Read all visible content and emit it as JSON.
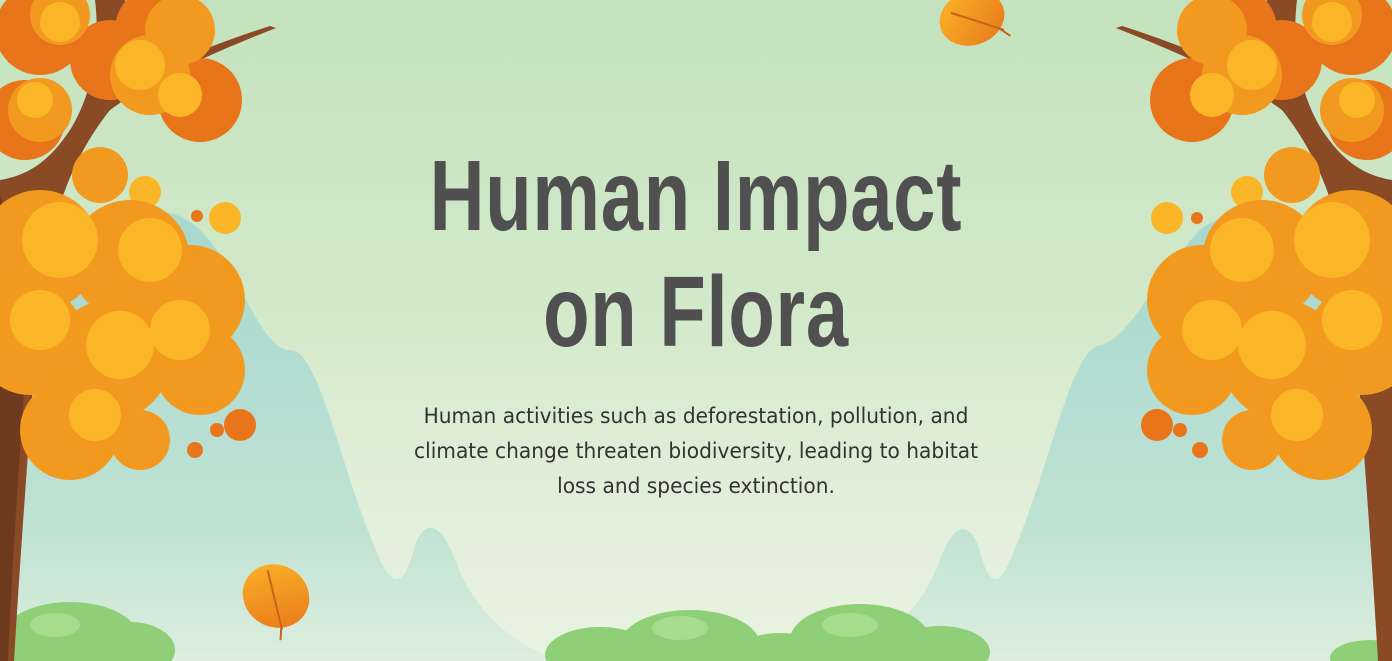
{
  "slide": {
    "title": "Human Impact on Flora",
    "subtitle": "Human activities such as deforestation, pollution, and climate change threaten biodiversity, leading to habitat loss and species extinction."
  },
  "colors": {
    "background": "#c8e4c0",
    "title": "#505050",
    "text": "#333333",
    "foliage_orange": "#f29a1f",
    "foliage_deep": "#e8751a",
    "foliage_yellow": "#fbb628",
    "trunk": "#8a4a26",
    "mountain": "#a8d8d0",
    "bush": "#8fcf78"
  },
  "decorations": [
    "autumn-tree-left",
    "autumn-tree-right",
    "mountain-left",
    "mountain-right",
    "falling-leaf-top",
    "falling-leaf-bottom",
    "bush-row"
  ]
}
